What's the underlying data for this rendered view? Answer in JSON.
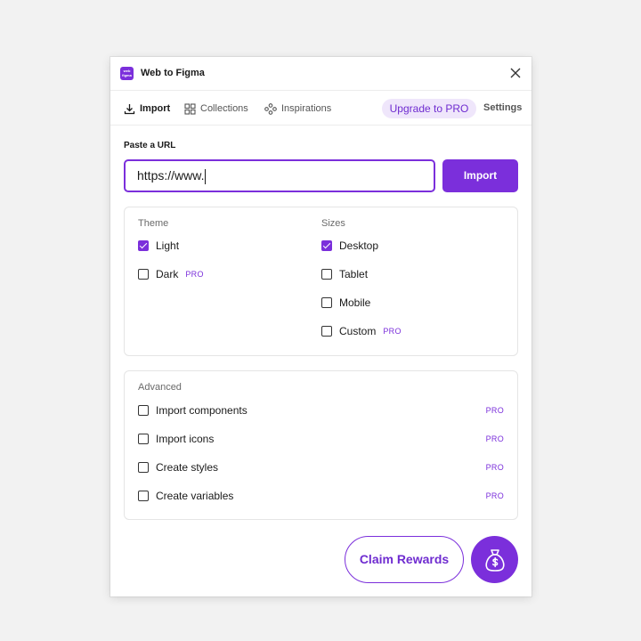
{
  "app": {
    "title": "Web to Figma",
    "logo_text": "web to figma",
    "accent_color": "#7b2fdb"
  },
  "tabs": {
    "import": "Import",
    "collections": "Collections",
    "inspirations": "Inspirations",
    "upgrade": "Upgrade to PRO",
    "settings": "Settings"
  },
  "url": {
    "label": "Paste a URL",
    "value": "https://www.",
    "button": "Import"
  },
  "theme": {
    "title": "Theme",
    "options": [
      {
        "label": "Light",
        "checked": true,
        "pro": ""
      },
      {
        "label": "Dark",
        "checked": false,
        "pro": "PRO"
      }
    ]
  },
  "sizes": {
    "title": "Sizes",
    "options": [
      {
        "label": "Desktop",
        "checked": true,
        "pro": ""
      },
      {
        "label": "Tablet",
        "checked": false,
        "pro": ""
      },
      {
        "label": "Mobile",
        "checked": false,
        "pro": ""
      },
      {
        "label": "Custom",
        "checked": false,
        "pro": "PRO"
      }
    ]
  },
  "advanced": {
    "title": "Advanced",
    "options": [
      {
        "label": "Import components",
        "checked": false,
        "pro": "PRO"
      },
      {
        "label": "Import icons",
        "checked": false,
        "pro": "PRO"
      },
      {
        "label": "Create styles",
        "checked": false,
        "pro": "PRO"
      },
      {
        "label": "Create variables",
        "checked": false,
        "pro": "PRO"
      }
    ]
  },
  "rewards": {
    "label": "Claim Rewards",
    "icon": "money-bag-icon"
  }
}
